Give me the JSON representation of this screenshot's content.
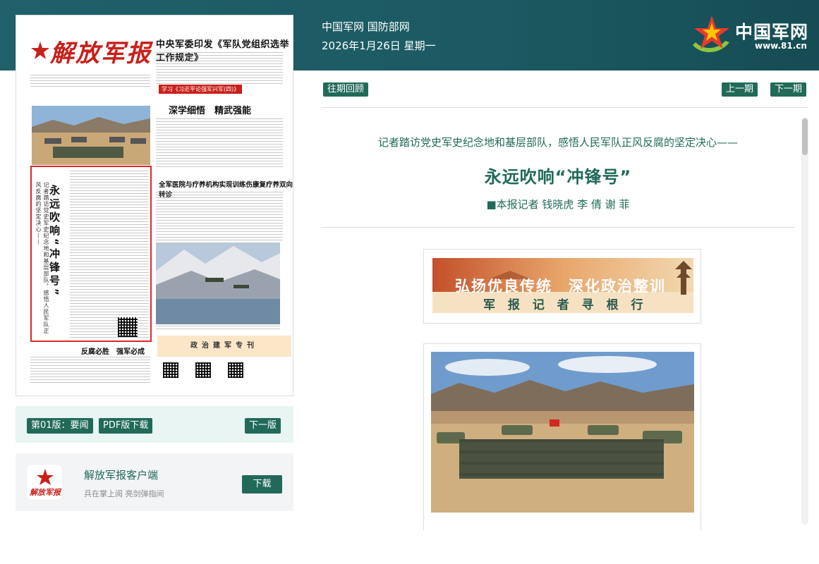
{
  "header": {
    "links": "中国军网 国防部网",
    "date": "2026年1月26日 星期一",
    "logo_text": "中国军网",
    "logo_url": "www.81.cn"
  },
  "paper": {
    "masthead": "解放军报",
    "headline": "中央军委印发《军队党组织选举工作规定》",
    "study_banner": "学习《习近平论强军兴军(四)》",
    "column_title": "深学细悟　精武强能",
    "lead_vertical_title": "永远吹响“冲锋号”",
    "lead_vertical_kicker": "记者踏访党史军史纪念地和基层部队，感悟人民军队正风反腐的坚定决心——",
    "lower_headline": "全军医院与疗养机构实现训练伤康复疗养双向转诊",
    "bottom_title": "反腐必胜　强军必成",
    "special_column": "政治建军专刊"
  },
  "toolbar": {
    "edition": "第01版：要闻",
    "pdf": "PDF版下载",
    "next_edition": "下一版"
  },
  "app": {
    "name": "解放军报客户端",
    "subtitle": "兵在掌上阅 亮剑弹指间",
    "download": "下载",
    "icon_text": "解放军报"
  },
  "nav": {
    "archive": "往期回顾",
    "prev_issue": "上一期",
    "next_issue": "下一期"
  },
  "article": {
    "kicker": "记者踏访党史军史纪念地和基层部队，感悟人民军队正风反腐的坚定决心——",
    "title": "永远吹响“冲锋号”",
    "byline": "■本报记者 钱晓虎 李 倩 谢 菲",
    "banner_line1": "弘扬优良传统　深化政治整训",
    "banner_line2": "军 报 记 者 寻 根 行"
  },
  "colors": {
    "header_bg": "#1b5a62",
    "accent_green": "#216a5a",
    "highlight_red": "#e0262a"
  }
}
